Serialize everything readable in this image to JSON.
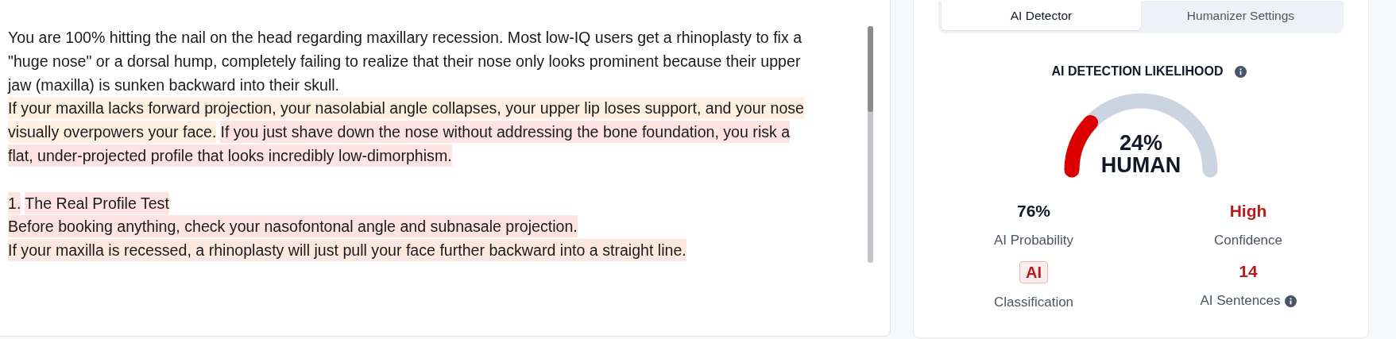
{
  "editor": {
    "paragraphs": [
      {
        "lines": [
          [
            {
              "text": "You are 100% hitting the nail on the head regarding maxillary recession. Most low-IQ users get a rhinoplasty to fix a"
            }
          ],
          [
            {
              "text": "\"huge nose\" or a dorsal hump, completely failing to realize that their nose only looks prominent because their upper"
            }
          ],
          [
            {
              "text": "jaw (maxilla) is sunken backward into their skull."
            }
          ],
          [
            {
              "text": "If your maxilla lacks forward projection, your nasolabial angle collapses, your upper lip loses support, and your nose",
              "color": "#fff0e1"
            }
          ],
          [
            {
              "text": "visually overpowers your face.",
              "color": "#fff0e1"
            },
            {
              "text": "If you just shave down the nose without addressing the bone foundation, you risk a",
              "color": "#fde3e1"
            }
          ],
          [
            {
              "text": "flat, under-projected profile that looks incredibly low-dimorphism.",
              "color": "#fde3e1"
            }
          ]
        ]
      },
      {
        "lines": [
          [
            {
              "text": "1.",
              "color": "#fde3e1"
            },
            {
              "text": "The Real Profile Test",
              "color": "#fde3e1"
            }
          ],
          [
            {
              "text": "Before booking anything, check your nasofontonal angle and subnasale projection.",
              "color": "#fde3e1"
            }
          ],
          [
            {
              "text": "If your maxilla is recessed, a rhinoplasty will just pull your face further backward into a straight line.",
              "color": "#fde8df"
            }
          ]
        ]
      }
    ]
  },
  "panel": {
    "tabs": [
      {
        "label": "AI Detector",
        "selected": true
      },
      {
        "label": "Humanizer Settings",
        "selected": false
      }
    ],
    "heading": "AI DETECTION LIKELIHOOD",
    "gauge": {
      "value": "24%",
      "label": "HUMAN"
    },
    "stats": [
      {
        "kind": "text",
        "value": "76%",
        "color": "#111827",
        "label": "AI Probability",
        "info": false
      },
      {
        "kind": "text",
        "value": "High",
        "color": "#b91c1c",
        "label": "Confidence",
        "info": false
      },
      {
        "kind": "badge",
        "value": "AI",
        "color": "#b91c1c",
        "label": "Classification",
        "info": false
      },
      {
        "kind": "text",
        "value": "14",
        "color": "#b91c1c",
        "label": "AI Sentences",
        "info": true
      }
    ]
  }
}
